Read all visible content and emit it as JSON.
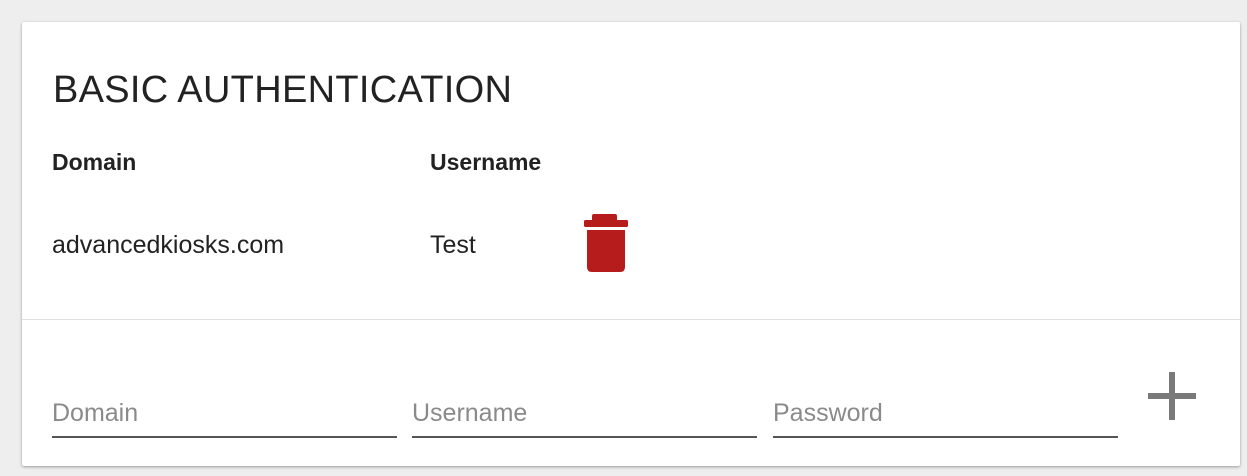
{
  "card": {
    "title": "BASIC AUTHENTICATION"
  },
  "table": {
    "headers": {
      "domain": "Domain",
      "username": "Username"
    },
    "rows": [
      {
        "domain": "advancedkiosks.com",
        "username": "Test",
        "action_icon": "trash-icon"
      }
    ]
  },
  "form": {
    "domain_placeholder": "Domain",
    "username_placeholder": "Username",
    "password_placeholder": "Password",
    "domain_value": "",
    "username_value": "",
    "password_value": "",
    "add_icon": "plus-icon"
  },
  "colors": {
    "delete": "#b71c1c",
    "add": "#7a7a7a",
    "text": "#222222",
    "placeholder": "#8a8a8a",
    "underline": "#555555",
    "background": "#eeeeee",
    "card": "#ffffff"
  }
}
